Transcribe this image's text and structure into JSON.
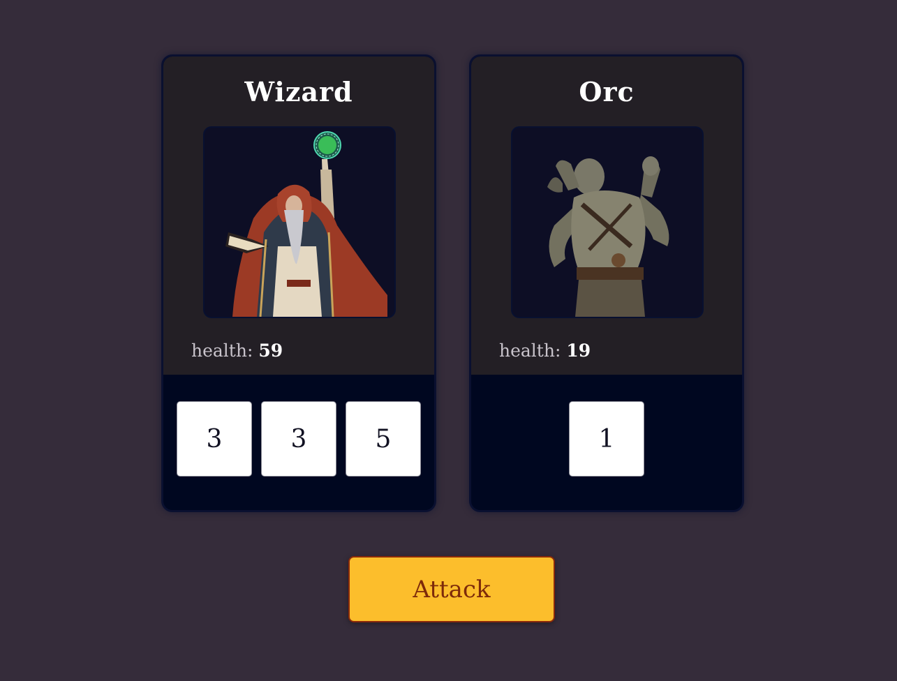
{
  "hero": {
    "name": "Wizard",
    "health_label": "health:",
    "health_value": "59",
    "portrait_icon": "wizard-portrait",
    "dice": [
      "3",
      "3",
      "5"
    ]
  },
  "monster": {
    "name": "Orc",
    "health_label": "health:",
    "health_value": "19",
    "portrait_icon": "orc-portrait",
    "dice": [
      "1"
    ]
  },
  "actions": {
    "attack_label": "Attack"
  },
  "colors": {
    "background": "#352c3a",
    "card_top": "#231f25",
    "card_bottom": "#000720",
    "attack_button": "#fcbe2c",
    "attack_text": "#7d2a0a"
  }
}
